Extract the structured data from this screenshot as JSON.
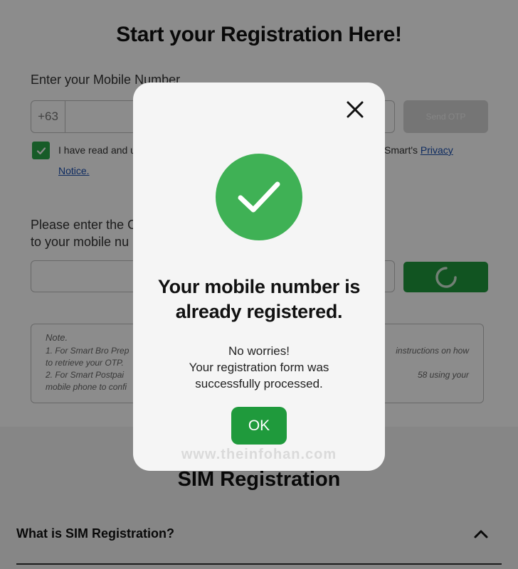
{
  "page": {
    "title": "Start your Registration Here!",
    "mobile_label": "Enter your Mobile Number",
    "country_code": "+63",
    "send_otp_label": "Send OTP",
    "consent_start": "I have read and u",
    "consent_end": "Smart's ",
    "consent_link_1": "Privacy",
    "consent_link_2": "Notice.",
    "otp_label_line1": "Please enter the O",
    "otp_label_line2": "to your mobile nu",
    "note": {
      "title": "Note.",
      "line1": "1. For Smart Bro Prep",
      "line1_tail": "instructions on how",
      "line2": "to retrieve your OTP.",
      "line3": "2. For Smart Postpai",
      "line3_tail": "58 using your",
      "line4": "mobile phone to confi"
    }
  },
  "faq": {
    "title": "SIM Registration",
    "item_1": "What is SIM Registration?"
  },
  "modal": {
    "heading": "Your mobile number is already registered.",
    "sub_line1": "No worries!",
    "sub_line2": "Your registration form was",
    "sub_line3": "successfully processed.",
    "ok_label": "OK",
    "watermark": "www.theinfohan.com"
  },
  "colors": {
    "brand_green": "#1f9a3c",
    "success_green": "#3fb155",
    "link_blue": "#1a4fb0"
  }
}
